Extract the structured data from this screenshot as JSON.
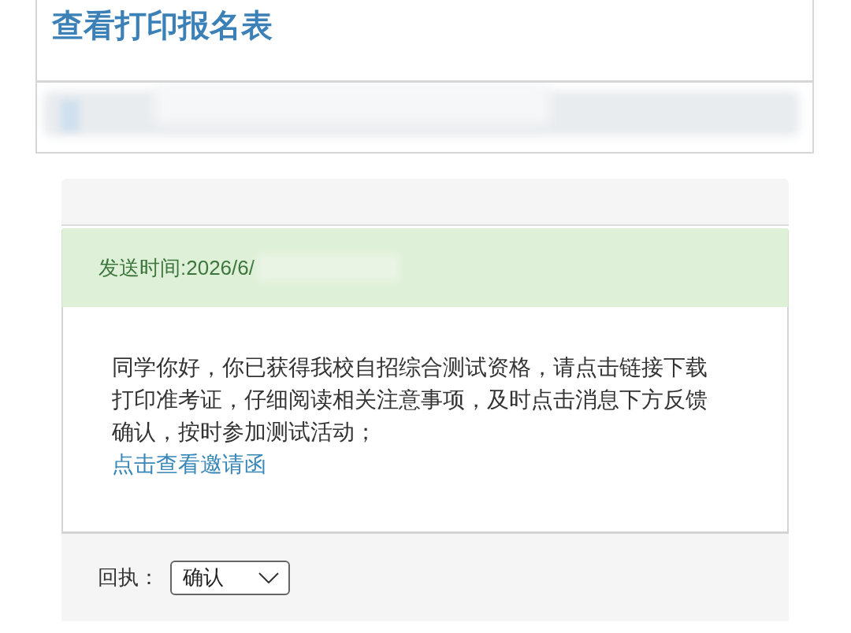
{
  "page_title": "查看打印报名表",
  "message": {
    "sent_time": "发送时间:2026/6/",
    "body": "同学你好，你已获得我校自招综合测试资格，请点击链接下载打印准考证，仔细阅读相关注意事项，及时点击消息下方反馈确认，按时参加测试活动；",
    "link": "点击查看邀请函"
  },
  "reply": {
    "label": "回执：",
    "value": "确认"
  }
}
